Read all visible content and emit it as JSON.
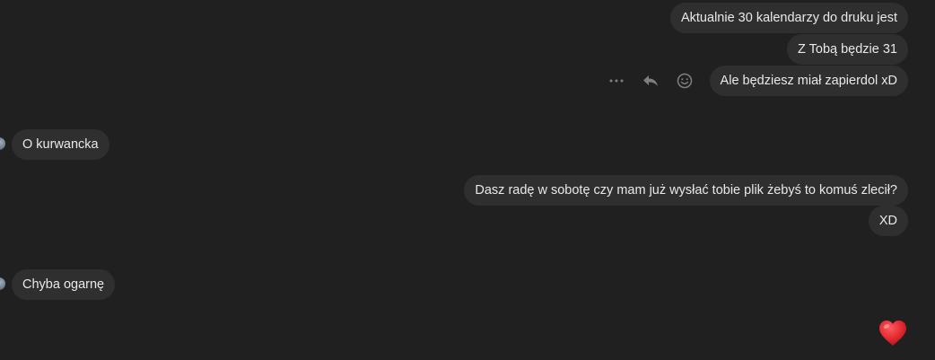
{
  "messages": {
    "m1": "Aktualnie 30 kalendarzy do druku jest",
    "m2": "Z Tobą będzie 31",
    "m3": "Ale będziesz miał zapierdol xD",
    "m4": "O kurwancka",
    "m5": "Dasz radę w sobotę czy mam już wysłać tobie plik żebyś to komuś zlecił?",
    "m6": "XD",
    "m7": "Chyba ogarnę"
  },
  "message_actions": {
    "icons": [
      "more-icon",
      "reply-icon",
      "emoji-react-icon"
    ]
  },
  "quick_reaction": {
    "icon": "heart-icon",
    "color": "#e0282f"
  },
  "colors": {
    "background": "#202020",
    "bubble": "#2f2f2f",
    "text": "#e9e9e9",
    "icon": "#8a8a8a"
  }
}
